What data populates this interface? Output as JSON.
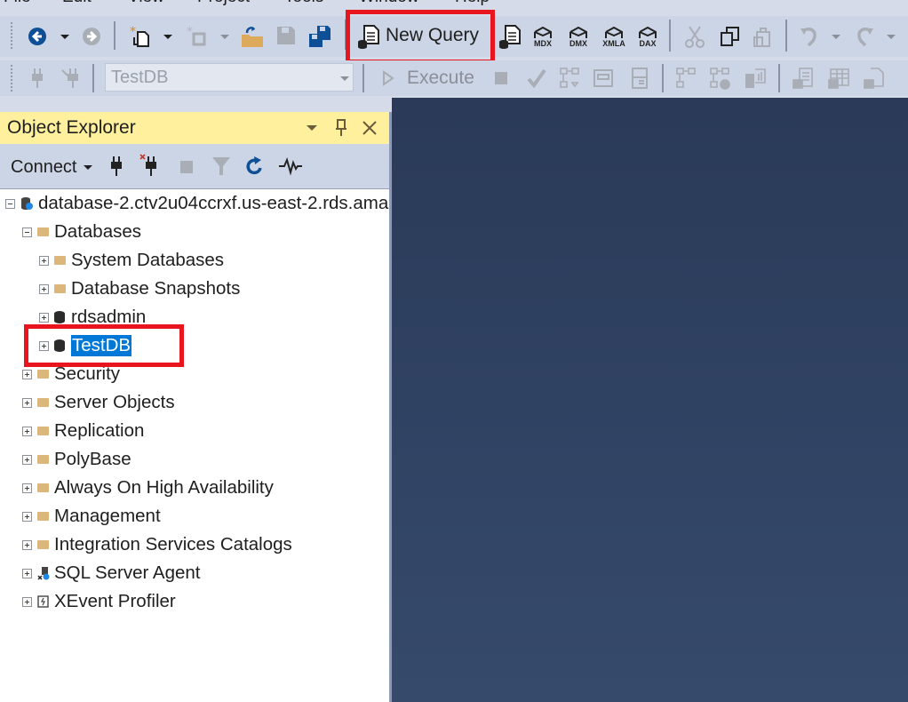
{
  "menubar": {
    "items": [
      "File",
      "Edit",
      "View",
      "Project",
      "Tools",
      "Window",
      "Help"
    ]
  },
  "toolbar_standard": {
    "icons": [
      "back-icon",
      "forward-icon",
      "new-project-icon",
      "add-item-icon",
      "open-file-icon",
      "save-icon",
      "save-all-icon",
      "new-query-icon",
      "database-engine-query-icon",
      "mdx-query-icon",
      "dmx-query-icon",
      "xmla-query-icon",
      "dax-query-icon",
      "cut-icon",
      "copy-icon",
      "paste-icon",
      "undo-icon",
      "redo-icon"
    ],
    "new_query_label": "New Query",
    "mdx_label": "MDX",
    "dmx_label": "DMX",
    "xmla_label": "XMLA",
    "dax_label": "DAX"
  },
  "toolbar_sql": {
    "database_selected": "TestDB",
    "execute_label": "Execute"
  },
  "object_explorer": {
    "title": "Object Explorer",
    "connect_label": "Connect",
    "tree": [
      {
        "label": "database-2.ctv2u04ccrxf.us-east-2.rds.ama",
        "expanded": true,
        "icon": "server-icon"
      },
      {
        "label": "Databases",
        "expanded": true,
        "icon": "folder-icon"
      },
      {
        "label": "System Databases",
        "expanded": false,
        "icon": "folder-icon"
      },
      {
        "label": "Database Snapshots",
        "expanded": false,
        "icon": "folder-icon"
      },
      {
        "label": "rdsadmin",
        "expanded": false,
        "icon": "database-icon"
      },
      {
        "label": "TestDB",
        "expanded": false,
        "icon": "database-icon",
        "selected": true
      },
      {
        "label": "Security",
        "expanded": false,
        "icon": "folder-icon"
      },
      {
        "label": "Server Objects",
        "expanded": false,
        "icon": "folder-icon"
      },
      {
        "label": "Replication",
        "expanded": false,
        "icon": "folder-icon"
      },
      {
        "label": "PolyBase",
        "expanded": false,
        "icon": "folder-icon"
      },
      {
        "label": "Always On High Availability",
        "expanded": false,
        "icon": "folder-icon"
      },
      {
        "label": "Management",
        "expanded": false,
        "icon": "folder-icon"
      },
      {
        "label": "Integration Services Catalogs",
        "expanded": false,
        "icon": "folder-icon"
      },
      {
        "label": "SQL Server Agent",
        "expanded": false,
        "icon": "agent-icon"
      },
      {
        "label": "XEvent Profiler",
        "expanded": false,
        "icon": "xevent-icon"
      }
    ]
  },
  "colors": {
    "highlight_box": "#e8141e",
    "selection": "#0078d7",
    "panel_title": "#fef09d",
    "workspace": "#2f4163"
  }
}
